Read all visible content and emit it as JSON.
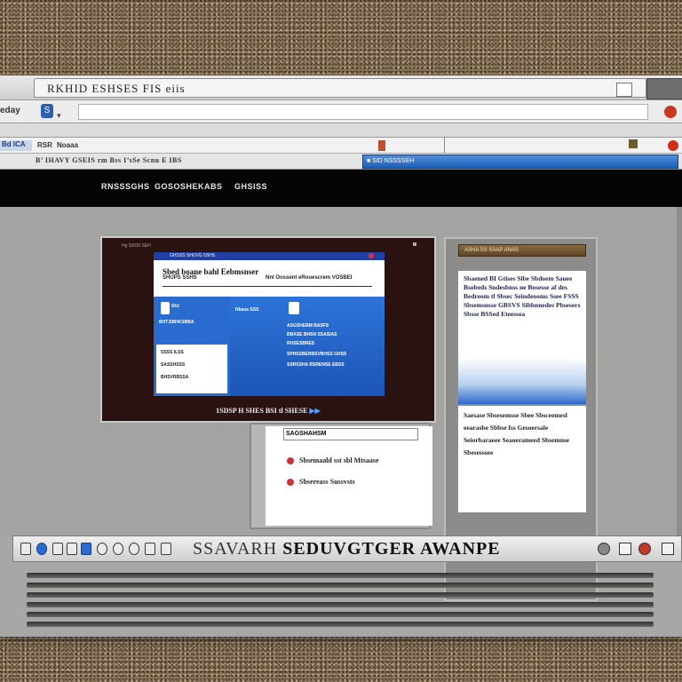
{
  "browser": {
    "title": "RKHID  ESHSES  FIS  eiis",
    "nav_label": "eday",
    "nav_icon_glyph": "S",
    "bookmarks": {
      "item1": "Bd ICA",
      "item2": "RSR",
      "item3": "Noaaa"
    },
    "tab_text": "B’ IHAVY GSEIS  rm Bss I’sSe Scnu  E IBS",
    "blue_tab_label": "■ SID  NSSSSEH"
  },
  "site_nav": [
    "RNSSSGHS",
    "GOSOSHEK",
    "ABS",
    "GHSISS"
  ],
  "video_screen": {
    "top_text": "Hg SSO0 SEH",
    "inner_top_label": "GHSSS  SHUVG 5SHS",
    "inner_title": "Sbed boane bahl Eebmsnser",
    "inner_sub_left": "SHUPS  SSHS",
    "inner_sub_right": "Nnl  Oossent  eRouescrem  VOSBEI",
    "left_col": [
      "Sh1",
      "BHT.SBHKSBBA",
      "SSSS  ILSS",
      "SASSHSSS",
      "BHSVRBSSA"
    ],
    "right_col": [
      "Nbasa  SSS",
      "ASGSHEBM  BASFS",
      "BBASE  BHSN  SSASIAS",
      "RHSESBRES",
      "SPHSSBERBSVBHSS  GHSS",
      "SSRSSHA  BSRENSE  EBSS"
    ],
    "caption": "1SDSP  H  SHES  BSI  tl  SHESE",
    "caption_play": "▶▶"
  },
  "card": {
    "header": "SAGSHAHSM",
    "items": [
      "Sbsemaabl  sst  sbl  Mtsaase",
      "Sbsereass  Sussvsts"
    ]
  },
  "right_panel": {
    "header": "ASHA  SS  SAAP  ANAS",
    "body1": "Sbaened  BI  Gtises  Sibe  Sbdoem  Sauee  Bsobeds  Sndesbnss  ne  Bosesse  af  des  Bedreom  tl  Sbsec  Seindeooms  Ssee  FSSS  Sbsemsnsse  GBSVS  Sibbnnedes  Pbsesers  Sbsse  BSSed  Eteessea",
    "body2": "Saesase  Sbsesemsse  Sbee  Sbsceemesl  eearasbe  Sbbse  fss  Gesoersale  Seiorbaraeee  Seaoerameed  Sbsemnse  Sbesesssee"
  },
  "taskbar": {
    "title_light": "SSAVARH ",
    "title_bold": "SEDUVGTGER AWANPE"
  },
  "colors": {
    "accent_blue": "#2d6ad0",
    "navbar": "#050505",
    "record_red": "#c8381e"
  }
}
